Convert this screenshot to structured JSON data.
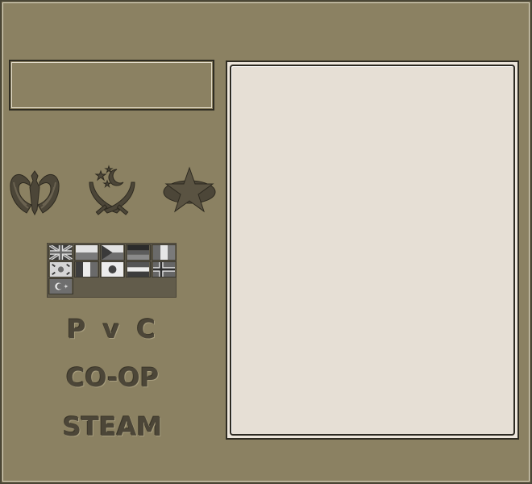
{
  "colors": {
    "background": "#8b8162",
    "panel": "#e6dfd5",
    "emblem": "#4c4638",
    "border": "#2f2c22"
  },
  "player_name": {
    "value": ""
  },
  "factions": [
    {
      "icon": "eagle-emblem-icon"
    },
    {
      "icon": "crescent-swords-emblem-icon"
    },
    {
      "icon": "star-emblem-icon"
    }
  ],
  "languages": [
    {
      "icon": "uk-flag-icon"
    },
    {
      "icon": "poland-flag-icon"
    },
    {
      "icon": "czech-flag-icon"
    },
    {
      "icon": "germany-flag-icon"
    },
    {
      "icon": "italy-flag-icon"
    },
    {
      "icon": "south-korea-flag-icon"
    },
    {
      "icon": "france-flag-icon"
    },
    {
      "icon": "japan-flag-icon"
    },
    {
      "icon": "netherlands-flag-icon"
    },
    {
      "icon": "norway-flag-icon"
    },
    {
      "icon": "turkey-flag-icon"
    }
  ],
  "modes": {
    "pvc": "P v C",
    "coop": "CO-OP",
    "steam": "STEAM"
  },
  "info_panel": {
    "text": ""
  }
}
